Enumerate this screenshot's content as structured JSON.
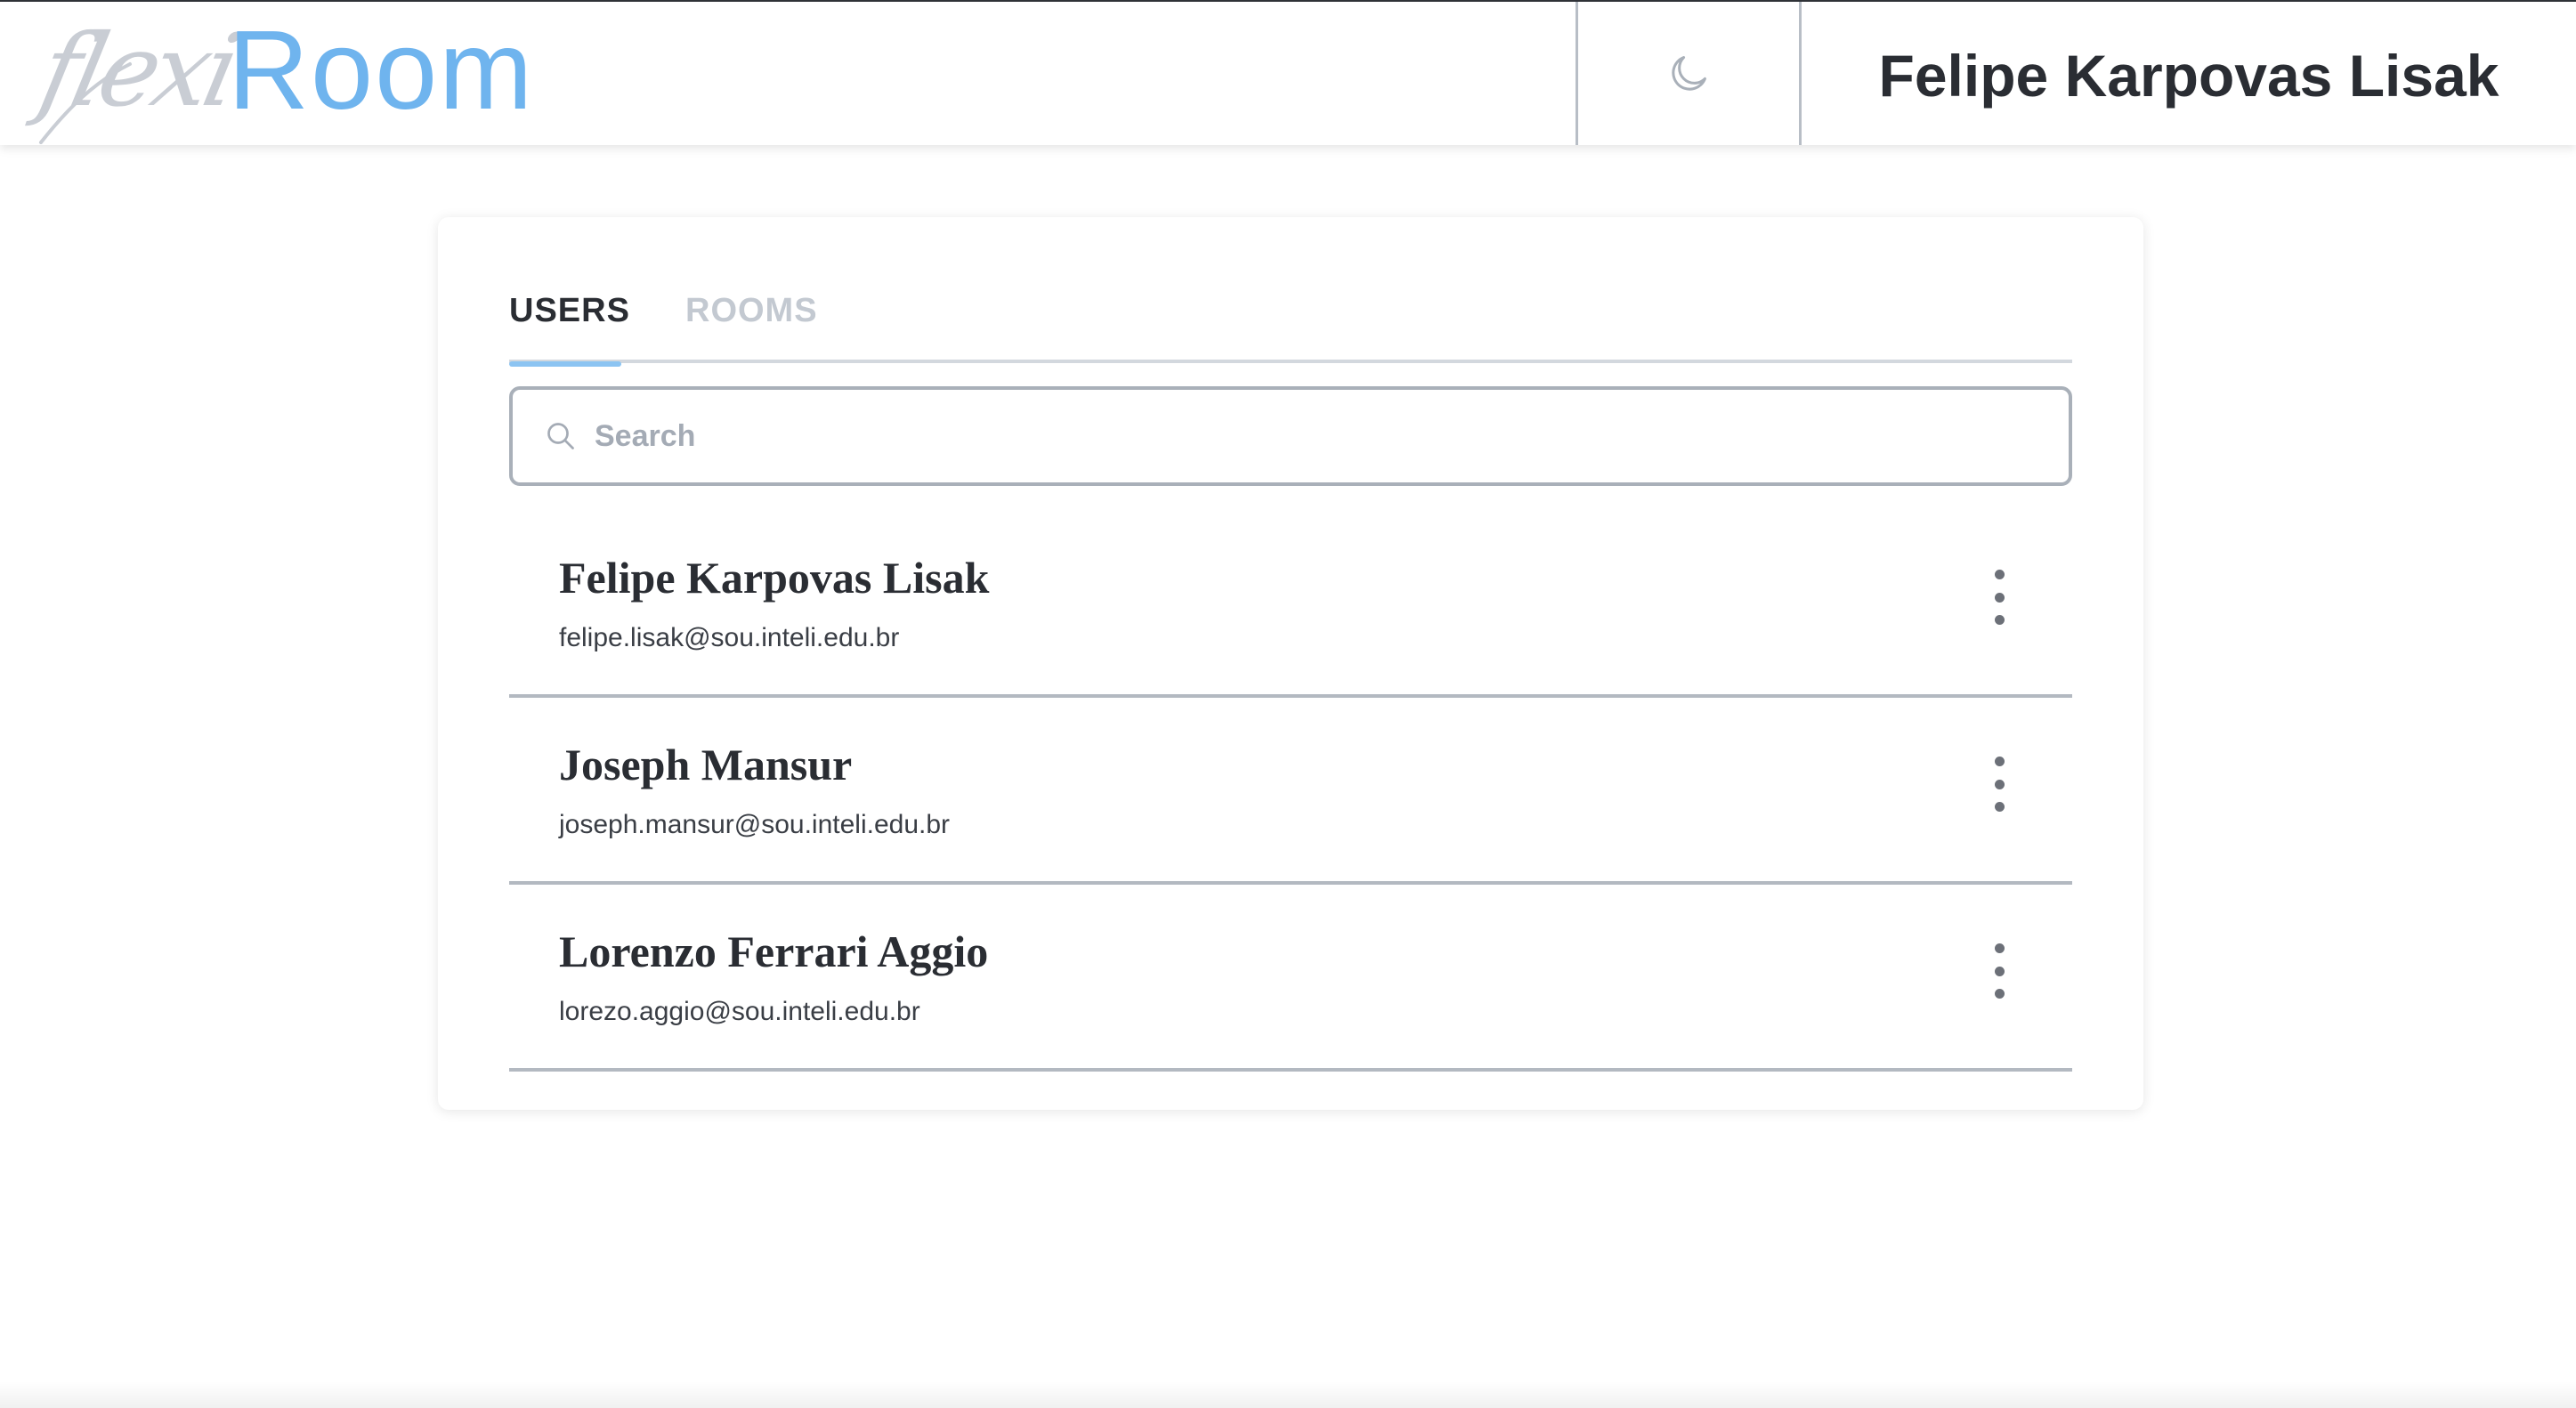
{
  "header": {
    "logo_script": "flexi",
    "logo_word": "Room",
    "theme_icon": "moon-icon",
    "current_user_name": "Felipe Karpovas Lisak"
  },
  "tabs": [
    {
      "label": "USERS",
      "active": true
    },
    {
      "label": "ROOMS",
      "active": false
    }
  ],
  "search": {
    "placeholder": "Search",
    "value": "",
    "icon": "search-icon"
  },
  "users": [
    {
      "name": "Felipe Karpovas Lisak",
      "email": "felipe.lisak@sou.inteli.edu.br",
      "menu_icon": "more-vertical-icon"
    },
    {
      "name": "Joseph Mansur",
      "email": "joseph.mansur@sou.inteli.edu.br",
      "menu_icon": "more-vertical-icon"
    },
    {
      "name": "Lorenzo Ferrari Aggio",
      "email": "lorezo.aggio@sou.inteli.edu.br",
      "menu_icon": "more-vertical-icon"
    }
  ],
  "colors": {
    "brand": "#6fb4ee",
    "tab_active_underline": "#8cc4f2",
    "text": "#2a2d33",
    "muted": "#c3c9d1"
  }
}
